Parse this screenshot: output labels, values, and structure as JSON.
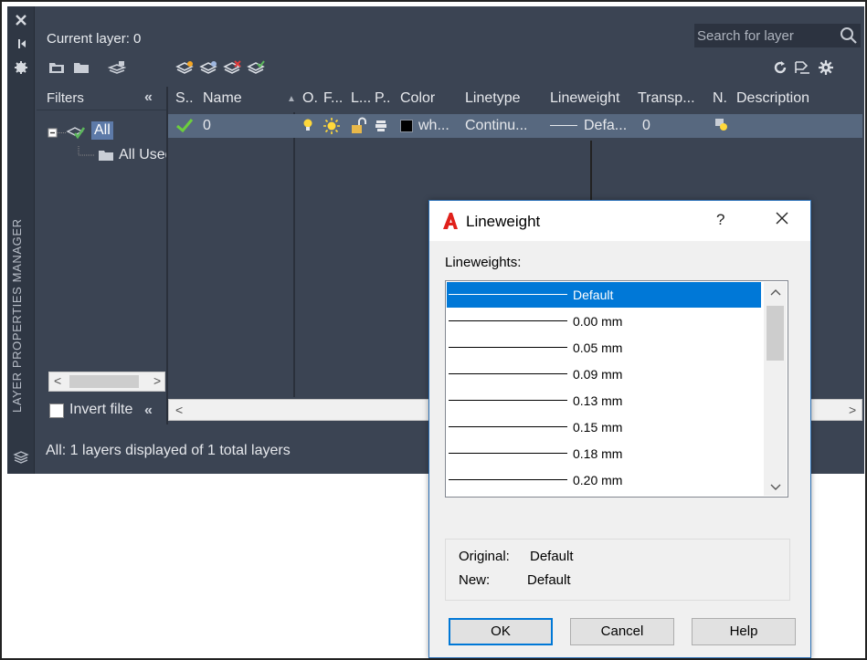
{
  "palette": {
    "side_title": "LAYER PROPERTIES MANAGER",
    "current_layer": "Current layer: 0",
    "search_placeholder": "Search for layer",
    "filters": {
      "header": "Filters",
      "collapse": "«",
      "tree_all": "All",
      "tree_all_used": "All Used Layers",
      "invert_label": "Invert filter",
      "invert_collapse": "«"
    },
    "columns": [
      "S..",
      "Name",
      "O.",
      "F...",
      "L...",
      "P..",
      "Color",
      "Linetype",
      "Lineweight",
      "Transp...",
      "N.",
      "Description"
    ],
    "row": {
      "status_icon": "check-icon",
      "name": "0",
      "color_swatch": "#000000",
      "color": "wh...",
      "linetype": "Continu...",
      "lineweight": "Defa...",
      "transparency": "0"
    },
    "status": "All: 1 layers displayed of 1 total layers",
    "colors": {
      "panel": "#3b4453",
      "selected_row": "#57687f",
      "accent_green": "#5cb85c"
    }
  },
  "dialog": {
    "title": "Lineweight",
    "help": "?",
    "lineweights_label": "Lineweights:",
    "items": [
      "Default",
      "0.00 mm",
      "0.05 mm",
      "0.09 mm",
      "0.13 mm",
      "0.15 mm",
      "0.18 mm",
      "0.20 mm"
    ],
    "selected_index": 0,
    "original_label": "Original:",
    "original_value": "Default",
    "new_label": "New:",
    "new_value": "Default",
    "buttons": {
      "ok": "OK",
      "cancel": "Cancel",
      "help": "Help"
    },
    "colors": {
      "selection": "#0078d7",
      "brand_red": "#e0211b"
    }
  }
}
